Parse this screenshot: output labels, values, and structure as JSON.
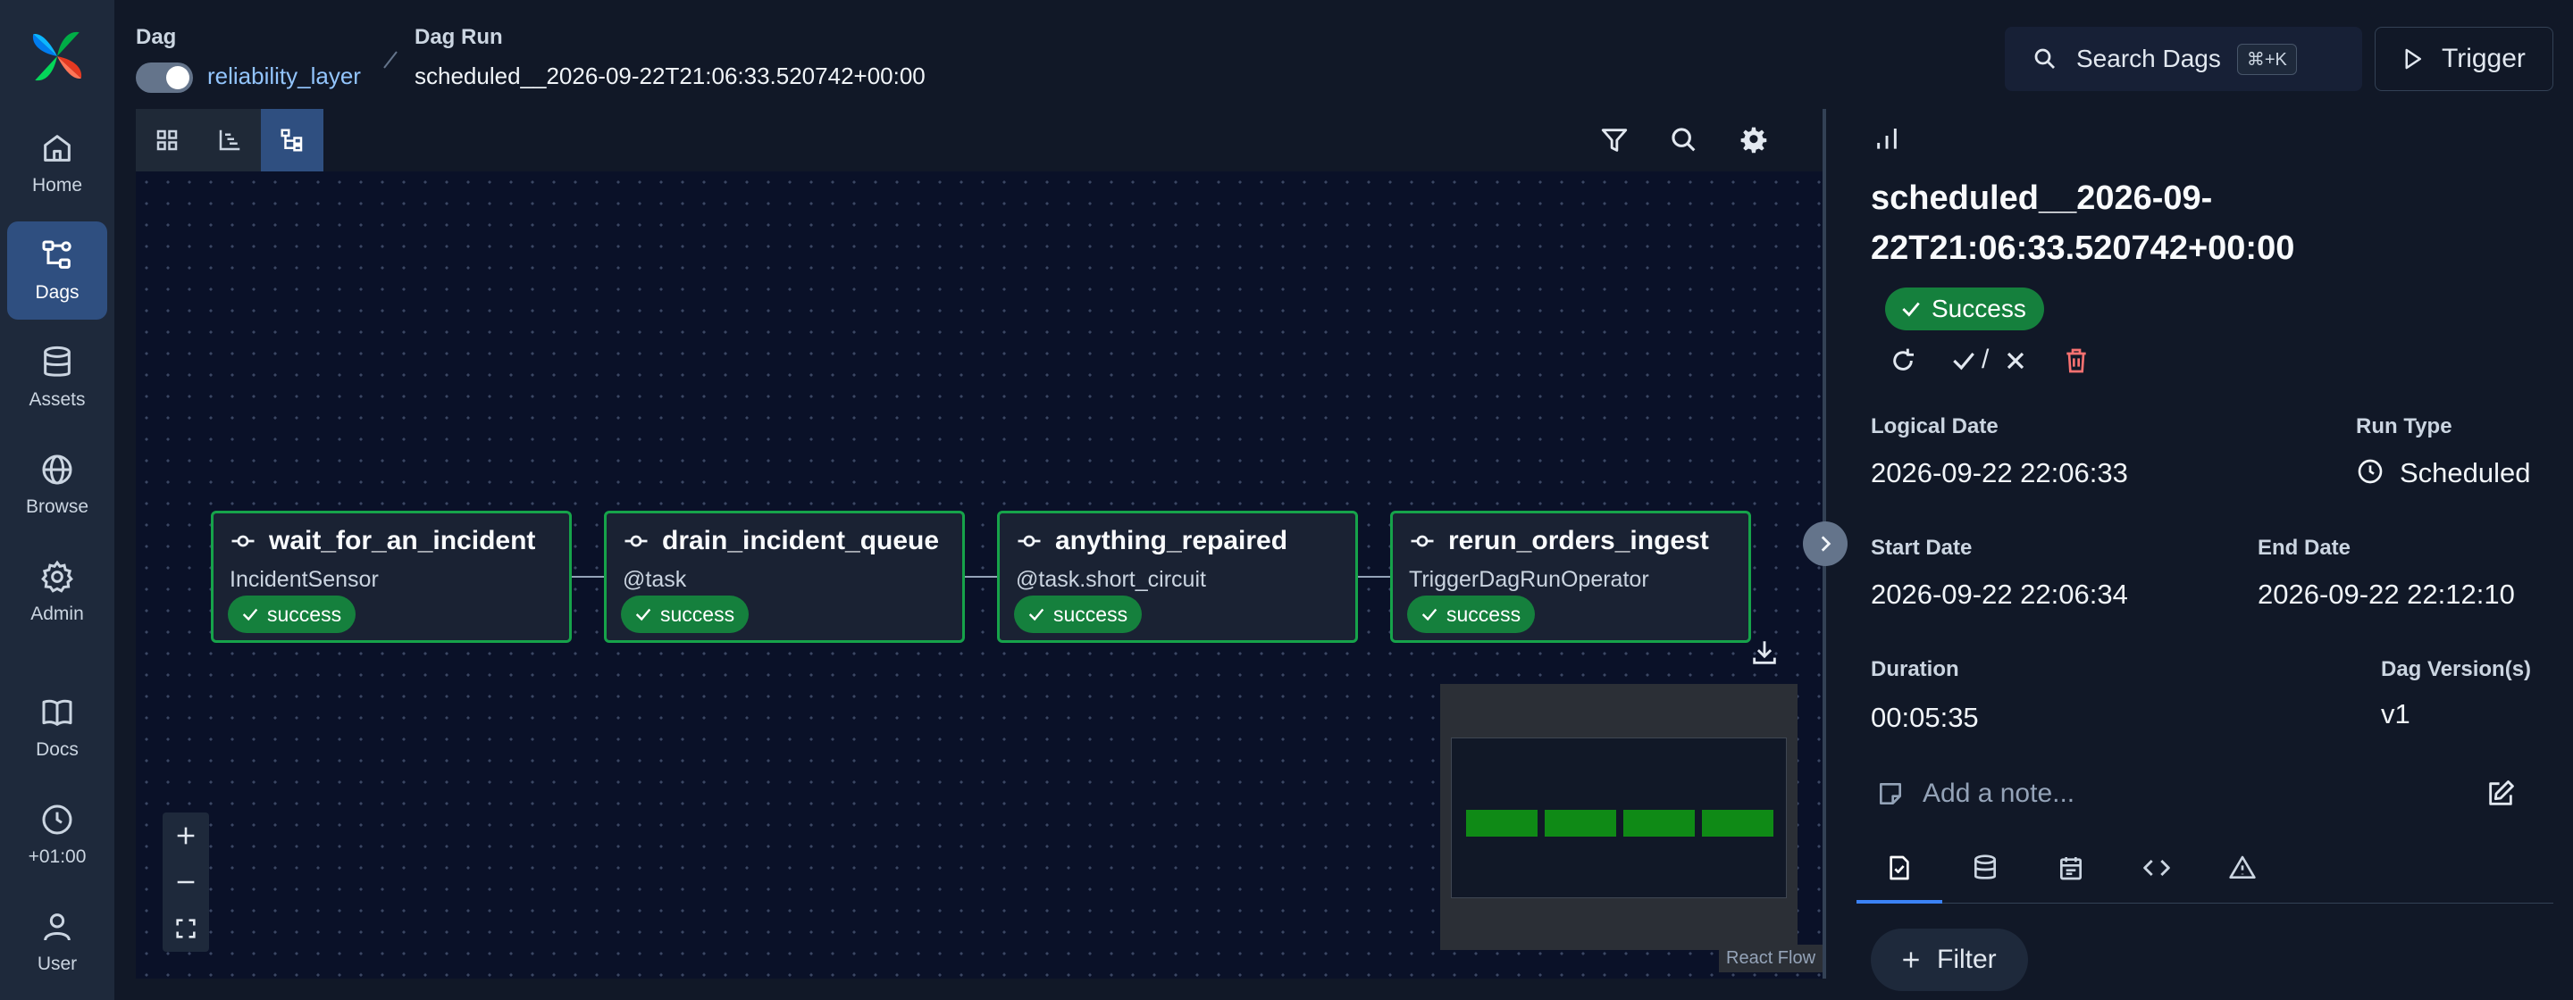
{
  "nav": {
    "items": [
      {
        "label": "Home",
        "icon": "home-icon"
      },
      {
        "label": "Dags",
        "icon": "dags-icon"
      },
      {
        "label": "Assets",
        "icon": "database-icon"
      },
      {
        "label": "Browse",
        "icon": "globe-icon"
      },
      {
        "label": "Admin",
        "icon": "gear-icon"
      },
      {
        "label": "Docs",
        "icon": "book-icon"
      },
      {
        "label": "+01:00",
        "icon": "clock-icon"
      },
      {
        "label": "User",
        "icon": "user-icon"
      }
    ]
  },
  "header": {
    "dag_label": "Dag",
    "dag_name": "reliability_layer",
    "run_label": "Dag Run",
    "run_id": "scheduled__2026-09-22T21:06:33.520742+00:00",
    "search_label": "Search Dags",
    "search_shortcut": "⌘+K",
    "trigger_label": "Trigger"
  },
  "graph": {
    "tasks": [
      {
        "name": "wait_for_an_incident",
        "operator": "IncidentSensor",
        "state": "success"
      },
      {
        "name": "drain_incident_queue",
        "operator": "@task",
        "state": "success"
      },
      {
        "name": "anything_repaired",
        "operator": "@task.short_circuit",
        "state": "success"
      },
      {
        "name": "rerun_orders_ingest",
        "operator": "TriggerDagRunOperator",
        "state": "success"
      }
    ],
    "attribution": "React Flow",
    "colors": {
      "success": "#15803d",
      "node_border": "#16a34a",
      "canvas": "#0a1128"
    }
  },
  "details": {
    "title": "scheduled__2026-09-22T21:06:33.520742+00:00",
    "state": "Success",
    "mark_as": "/",
    "logical_date_label": "Logical Date",
    "logical_date": "2026-09-22 22:06:33",
    "run_type_label": "Run Type",
    "run_type": "Scheduled",
    "start_date_label": "Start Date",
    "start_date": "2026-09-22 22:06:34",
    "end_date_label": "End Date",
    "end_date": "2026-09-22 22:12:10",
    "duration_label": "Duration",
    "duration": "00:05:35",
    "dag_version_label": "Dag Version(s)",
    "dag_version": "v1",
    "note_placeholder": "Add a note...",
    "filter_label": "Filter"
  }
}
